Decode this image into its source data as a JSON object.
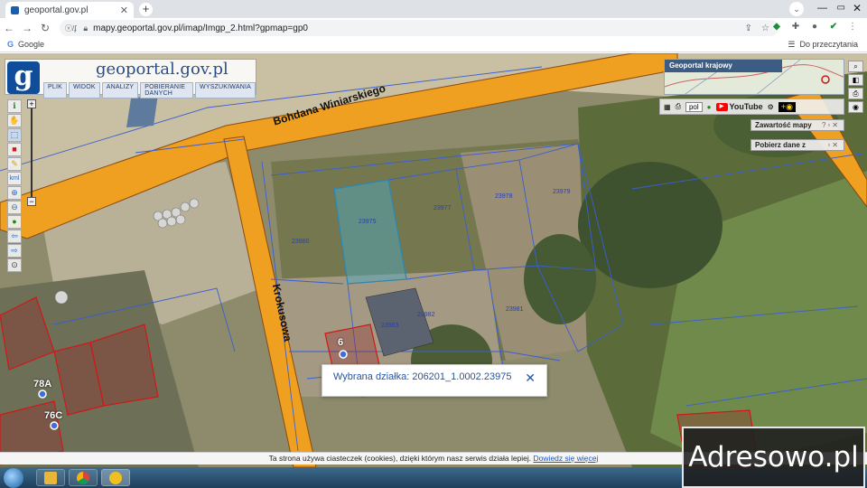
{
  "browser": {
    "tab_title": "geoportal.gov.pl",
    "tab_close": "✕",
    "new_tab": "+",
    "url": "mapy.geoportal.gov.pl/imap/Imgp_2.html?gpmap=gp0",
    "bookmark_google": "Google",
    "reading_list": "Do przeczytania"
  },
  "map": {
    "logo_letter": "g",
    "logo_text": "geoportal.gov.pl",
    "menu": [
      "PLIK",
      "WIDOK",
      "ANALIZY",
      "POBIERANIE DANYCH",
      "WYSZUKIWANIA"
    ],
    "overview_title": "Geoportal krajowy",
    "language": "pol",
    "youtube_label": "YouTube",
    "panels": {
      "map_contents": "Zawartość mapy",
      "download": "Pobierz dane z"
    },
    "streets": {
      "main": "Bohdana Winiarskiego",
      "side": "Krokusowa"
    },
    "addresses": {
      "a": "6",
      "b": "78A",
      "c": "76C"
    },
    "parcel_numbers": [
      "23975",
      "23982",
      "23983",
      "23977",
      "23978",
      "23979",
      "23980",
      "23981"
    ],
    "selection": {
      "text": "Wybrana działka: 206201_1.0002.23975",
      "close": "✕"
    }
  },
  "cookie": {
    "text": "Ta strona używa ciasteczek (cookies), dzięki którym nasz serwis działa lepiej.",
    "link": "Dowiedz się więcej"
  },
  "watermark": "Adresowo.pl",
  "colors": {
    "road": "#f0a020",
    "parcel_line": "#3a5fd0",
    "selected_parcel": "#4aa8c8",
    "building_red": "#d01818"
  }
}
